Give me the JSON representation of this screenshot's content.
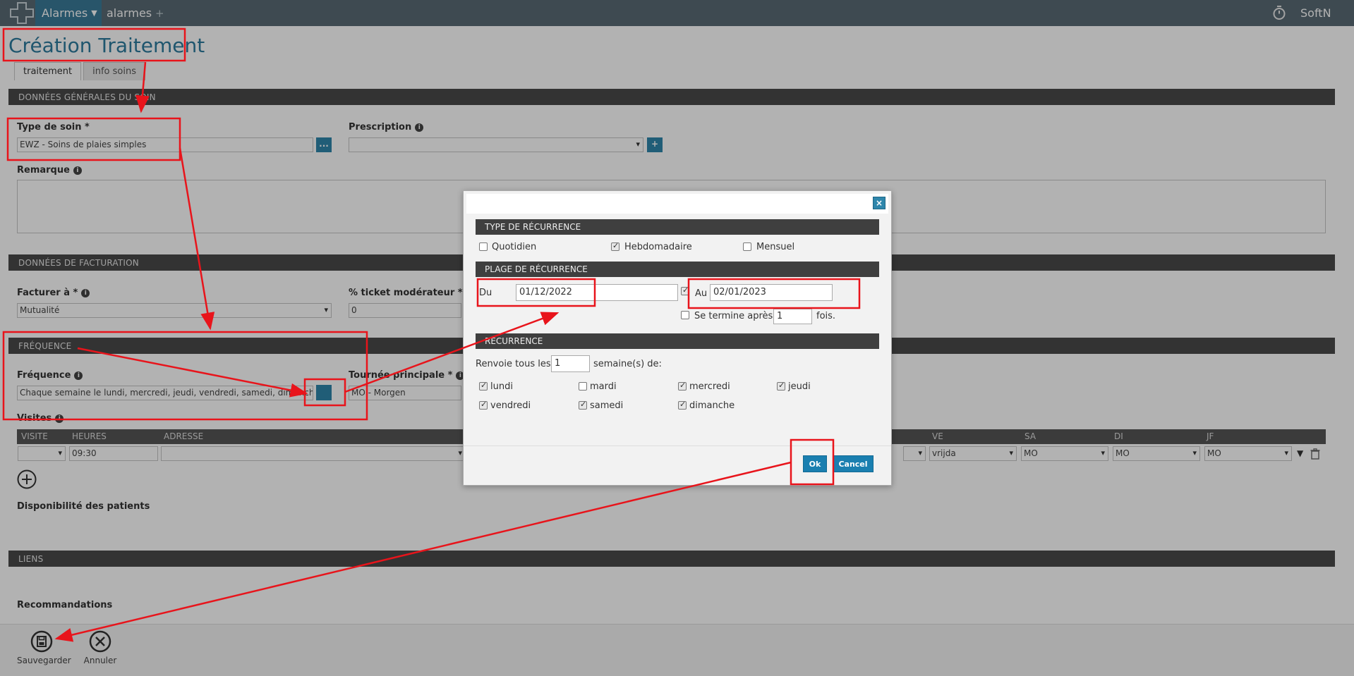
{
  "topbar": {
    "app_menu_label": "Alarmes",
    "tab_label": "alarmes",
    "plus": "+",
    "user": "SoftN"
  },
  "page": {
    "title": "Création Traitement",
    "tabs": [
      "traitement",
      "info soins"
    ]
  },
  "sections": {
    "general": "DONNÉES GÉNÉRALES DU SOIN",
    "billing": "DONNÉES DE FACTURATION",
    "frequency": "FRÉQUENCE",
    "links": "LIENS"
  },
  "general": {
    "type_label": "Type de soin *",
    "type_value": "EWZ - Soins de plaies simples",
    "type_btn": "...",
    "prescription_label": "Prescription",
    "prescription_add": "+",
    "remark_label": "Remarque"
  },
  "billing": {
    "bill_to_label": "Facturer à *",
    "bill_to_value": "Mutualité",
    "ticket_label": "% ticket modérateur *",
    "ticket_value": "0"
  },
  "frequency": {
    "label": "Fréquence",
    "value": "Chaque semaine le lundi, mercredi, jeudi, vendredi, samedi, dimanche",
    "tour_label": "Tournée principale *",
    "tour_value": "MO - Morgen",
    "visits_label": "Visites",
    "table_headers": [
      "VISITE",
      "HEURES",
      "ADRESSE",
      "VE",
      "SA",
      "DI",
      "JF"
    ],
    "row": {
      "time": "09:30",
      "ve": "vrijda",
      "sa": "MO",
      "di": "MO",
      "jf": "MO"
    },
    "availability_label": "Disponibilité des patients"
  },
  "links": {
    "recommendations_label": "Recommandations"
  },
  "toolbar": {
    "save_label": "Sauvegarder",
    "cancel_label": "Annuler"
  },
  "modal": {
    "close": "×",
    "recurrence_type_title": "TYPE DE RÉCURRENCE",
    "types": [
      {
        "label": "Quotidien",
        "checked": false
      },
      {
        "label": "Hebdomadaire",
        "checked": true
      },
      {
        "label": "Mensuel",
        "checked": false
      }
    ],
    "range_title": "PLAGE DE RÉCURRENCE",
    "from_label": "Du",
    "from_value": "01/12/2022",
    "to_label": "Au",
    "to_value": "02/01/2023",
    "end_after_label": "Se termine après",
    "end_after_value": "1",
    "end_after_suffix": "fois.",
    "recurrence_title": "RECURRENCE",
    "repeat_prefix": "Renvoie tous les",
    "repeat_value": "1",
    "repeat_suffix": "semaine(s) de:",
    "days": [
      {
        "label": "lundi",
        "checked": true
      },
      {
        "label": "mardi",
        "checked": false
      },
      {
        "label": "mercredi",
        "checked": true
      },
      {
        "label": "jeudi",
        "checked": true
      },
      {
        "label": "vendredi",
        "checked": true
      },
      {
        "label": "samedi",
        "checked": true
      },
      {
        "label": "dimanche",
        "checked": true
      }
    ],
    "ok_label": "Ok",
    "cancel_label": "Cancel"
  },
  "colors": {
    "accent": "#2e86ab",
    "annotation": "#e8141b"
  }
}
